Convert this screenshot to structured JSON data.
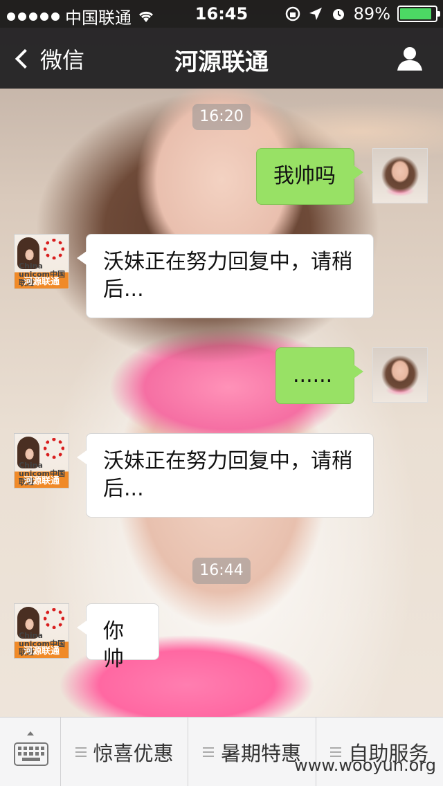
{
  "status_bar": {
    "carrier": "中国联通",
    "time": "16:45",
    "battery_percent": "89%",
    "battery_level": 0.89,
    "colors": {
      "battery": "#4cd964"
    }
  },
  "nav": {
    "back_label": "微信",
    "title": "河源联通",
    "right_icon": "person-icon"
  },
  "chat": {
    "timestamps": [
      "16:20",
      "16:44"
    ],
    "messages": [
      {
        "sender": "self",
        "text": "我帅吗"
      },
      {
        "sender": "other",
        "text": "沃妹正在努力回复中，请稍后..."
      },
      {
        "sender": "self",
        "text": "......"
      },
      {
        "sender": "other",
        "text": "沃妹正在努力回复中，请稍后..."
      },
      {
        "sender": "other",
        "text": "你帅"
      }
    ],
    "other_avatar": {
      "brand_en_1": "China",
      "brand_en_2": "unicom中国联通",
      "tag": "河源联通"
    },
    "colors": {
      "self_bubble": "#98e165",
      "other_bubble": "#ffffff",
      "avatar_tag": "#f08a28"
    }
  },
  "bottom_menu": {
    "keyboard_icon": "keyboard-icon",
    "items": [
      "惊喜优惠",
      "暑期特惠",
      "自助服务"
    ]
  },
  "watermark": "www.wooyun.org"
}
